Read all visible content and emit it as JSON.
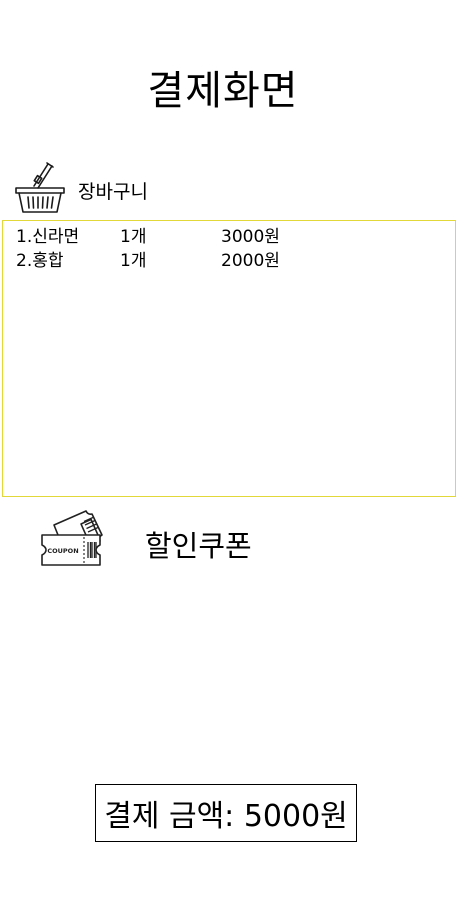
{
  "header": {
    "title": "결제화면"
  },
  "cart": {
    "icon": "basket-icon",
    "label": "장바구니",
    "border_color": "#e3d83a",
    "items": [
      {
        "name": "1.신라면",
        "qty": "1개",
        "price": "3000원"
      },
      {
        "name": "2.홍합",
        "qty": "1개",
        "price": "2000원"
      }
    ]
  },
  "coupon": {
    "icon": "coupon-icon",
    "icon_text": "COUPON",
    "label": "할인쿠폰"
  },
  "payment": {
    "total_text": "결제 금액: 5000원"
  }
}
